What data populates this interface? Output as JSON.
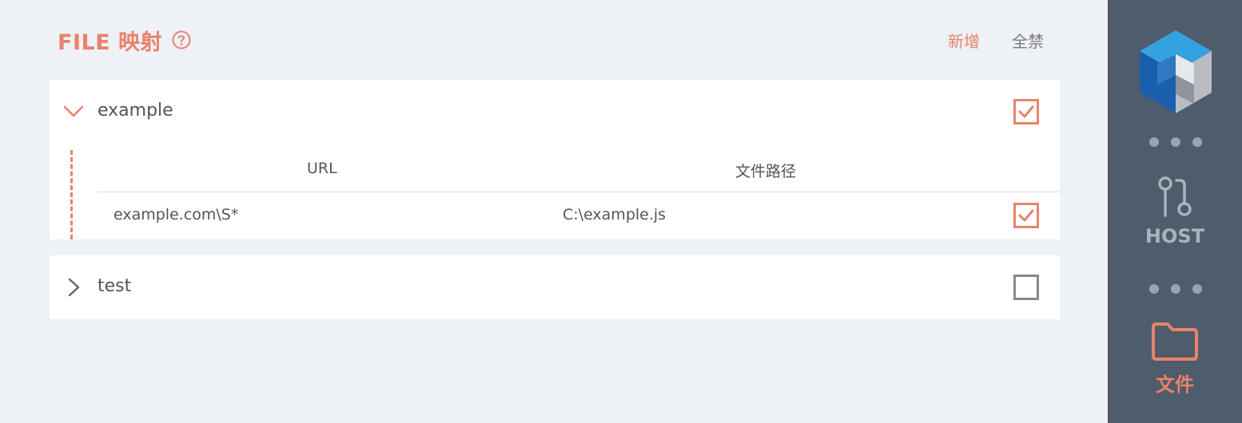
{
  "header": {
    "title": "FILE 映射",
    "help_icon": "question-circle-icon",
    "actions": {
      "add": "新增",
      "disable_all": "全禁"
    }
  },
  "groups": [
    {
      "name": "example",
      "expanded": true,
      "enabled": true,
      "columns": {
        "url": "URL",
        "path": "文件路径"
      },
      "rules": [
        {
          "url": "example.com\\S*",
          "path": "C:\\example.js",
          "enabled": true
        }
      ]
    },
    {
      "name": "test",
      "expanded": false,
      "enabled": false
    }
  ],
  "sidebar": {
    "logo": "cube-logo",
    "items": [
      {
        "label": "HOST",
        "icon": "git-compare-icon",
        "active": false
      },
      {
        "label": "文件",
        "icon": "folder-icon",
        "active": true
      }
    ]
  },
  "colors": {
    "accent": "#e8836a",
    "background": "#eef1f5",
    "sidebar": "#4f5c6b",
    "panel": "#ffffff"
  }
}
